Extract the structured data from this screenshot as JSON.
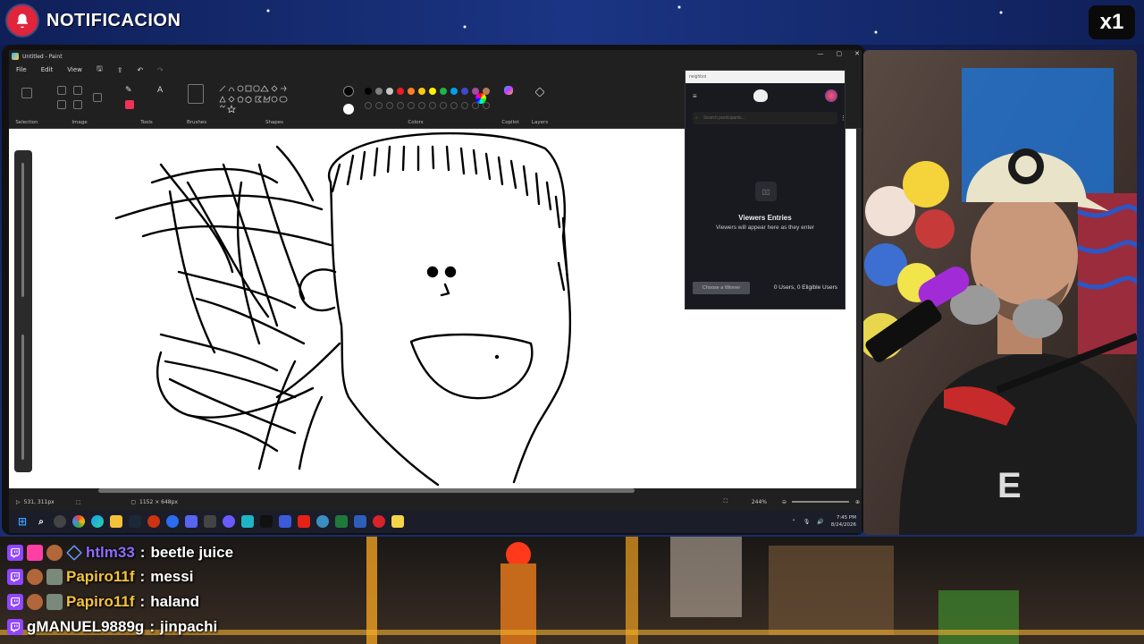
{
  "overlay": {
    "notification_label": "NOTIFICACION",
    "multiplier": "x1"
  },
  "paint": {
    "window_title": "Untitled - Paint",
    "menu": [
      "File",
      "Edit",
      "View"
    ],
    "ribbon_groups": [
      "Selection",
      "Image",
      "Tools",
      "Brushes",
      "Shapes",
      "Colors",
      "Copilot",
      "Layers"
    ],
    "status": {
      "cursor_position": "531, 311px",
      "canvas_size": "1152 × 648px",
      "zoom": "244%"
    },
    "palette_colors": [
      "#000000",
      "#7f7f7f",
      "#c8c8c8",
      "#ed1c24",
      "#ff7f27",
      "#ffc90e",
      "#fff200",
      "#22b14c",
      "#00a2e8",
      "#3f48cc",
      "#a349a4",
      "#b97a57"
    ]
  },
  "viewer_panel": {
    "top_bar": "neighbot",
    "search_placeholder": "Search participants...",
    "empty_title": "Viewers Entries",
    "empty_subtitle": "Viewers will appear here as they enter",
    "choose_winner_label": "Choose a Winner",
    "count_label": "0 Users, 0 Eligible Users"
  },
  "taskbar": {
    "time": "7:45 PM",
    "date": "8/24/2026"
  },
  "chat": {
    "messages": [
      {
        "user": "htlm33",
        "user_color": "#8f6bff",
        "text": "beetle juice"
      },
      {
        "user": "Papiro11f",
        "user_color": "#f5c33b",
        "text": "messi"
      },
      {
        "user": "Papiro11f",
        "user_color": "#f5c33b",
        "text": "haland"
      },
      {
        "user": "gMANUEL9889g",
        "user_color": "#ffffff",
        "text": "jinpachi"
      }
    ]
  }
}
